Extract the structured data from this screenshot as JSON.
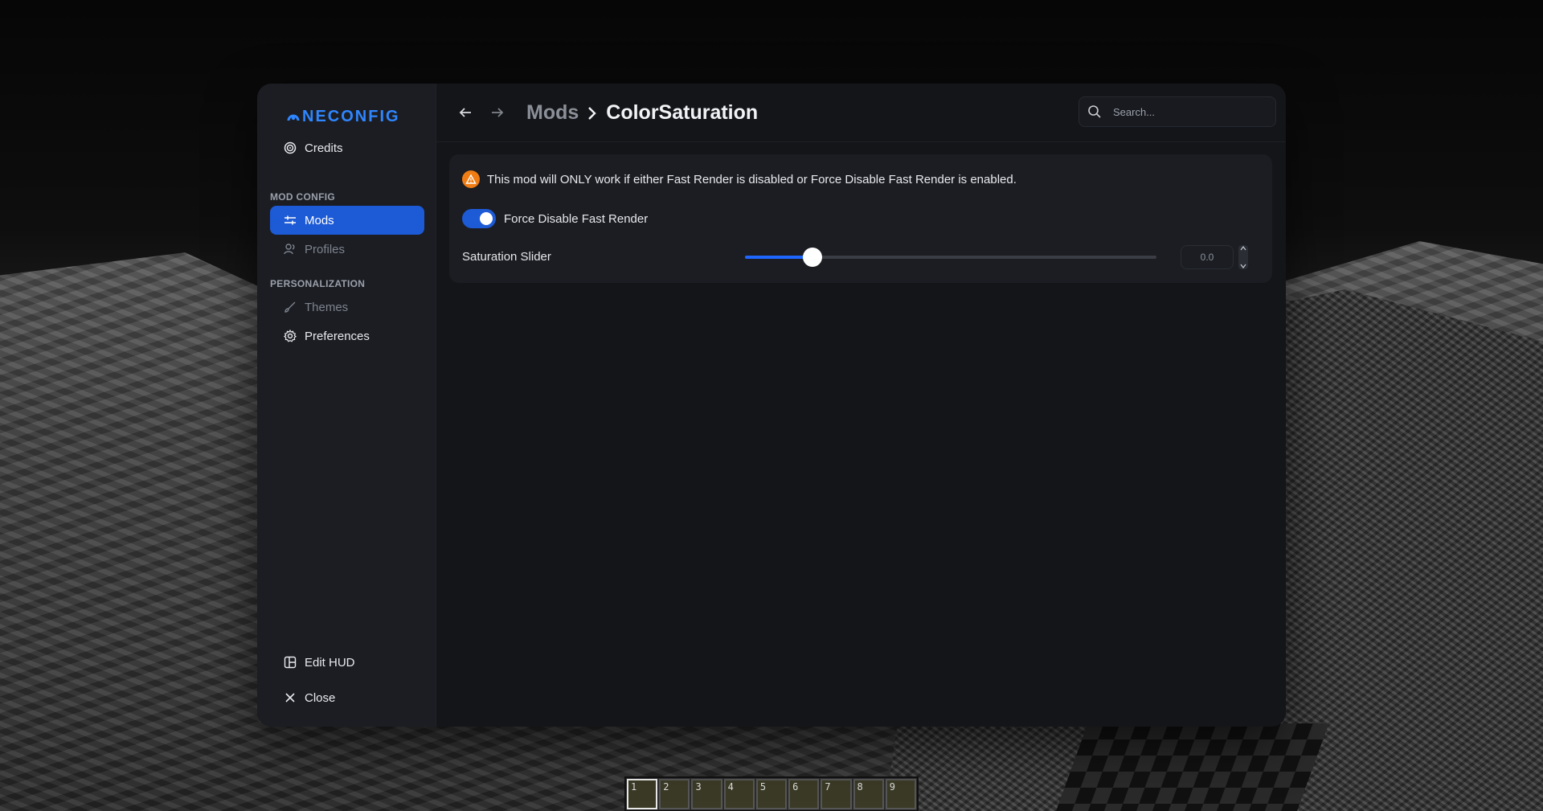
{
  "app": {
    "logo_text": "NECONFIG",
    "accent_color": "#1d5ad6",
    "warning_color": "#f07c14"
  },
  "sidebar": {
    "credits_label": "Credits",
    "section_mod_config": "MOD CONFIG",
    "mods_label": "Mods",
    "profiles_label": "Profiles",
    "section_personalization": "PERSONALIZATION",
    "themes_label": "Themes",
    "preferences_label": "Preferences",
    "edit_hud_label": "Edit HUD",
    "close_label": "Close"
  },
  "header": {
    "breadcrumb_parent": "Mods",
    "breadcrumb_current": "ColorSaturation",
    "search_placeholder": "Search..."
  },
  "config": {
    "warning_text": "This mod will ONLY work if either Fast Render is disabled or Force Disable Fast Render is enabled.",
    "toggle_label": "Force Disable Fast Render",
    "toggle_on": true,
    "slider_label": "Saturation Slider",
    "slider_value_text": "0.0",
    "slider_fraction": 0.165
  },
  "hotbar": {
    "slots": [
      "1",
      "2",
      "3",
      "4",
      "5",
      "6",
      "7",
      "8",
      "9"
    ],
    "selected": 0
  }
}
